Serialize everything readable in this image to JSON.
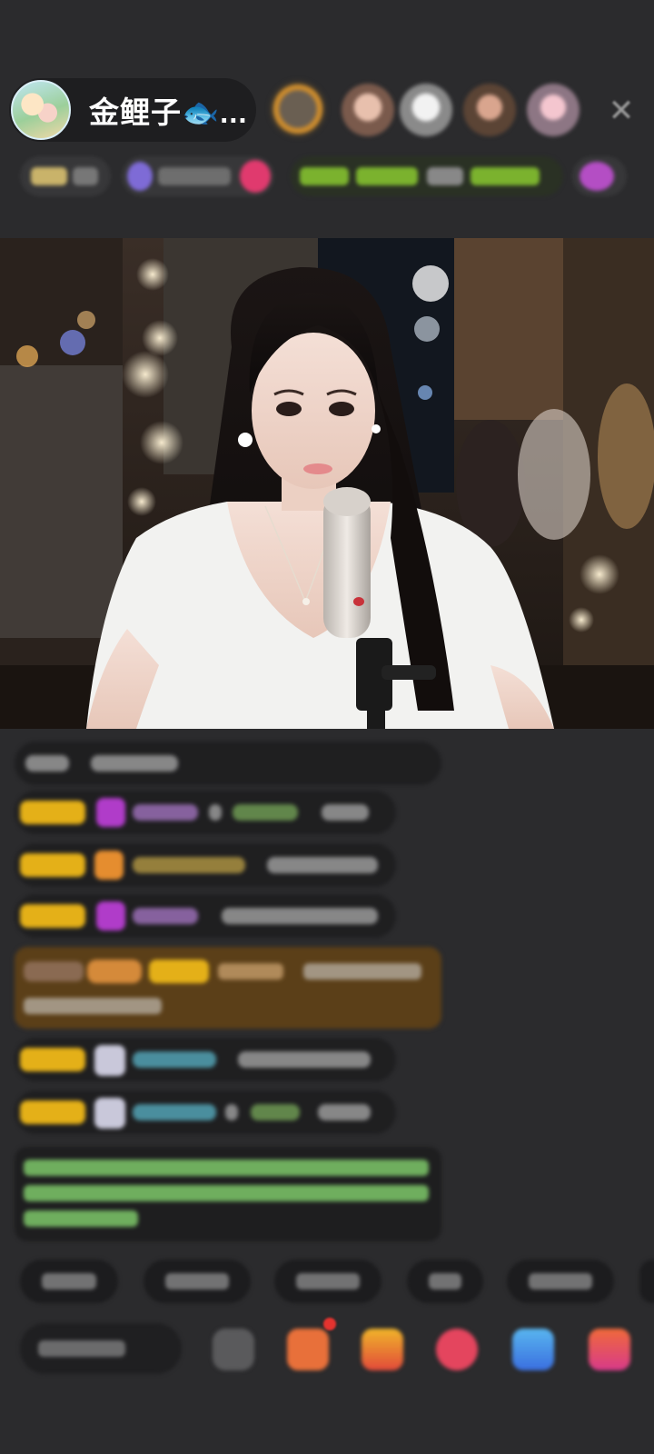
{
  "header": {
    "host_name": "金鲤子🐟...",
    "host_avatar_icon": "host-avatar",
    "viewer_avatar_count": 5,
    "close_icon": "close-icon"
  },
  "video": {
    "description_icon": "live-video-stream"
  },
  "colors": {
    "background": "#2b2b2d",
    "badge_gold": "#e4b018",
    "highlight_brown": "#6b4a1c",
    "notice_green": "#7cc46a"
  }
}
